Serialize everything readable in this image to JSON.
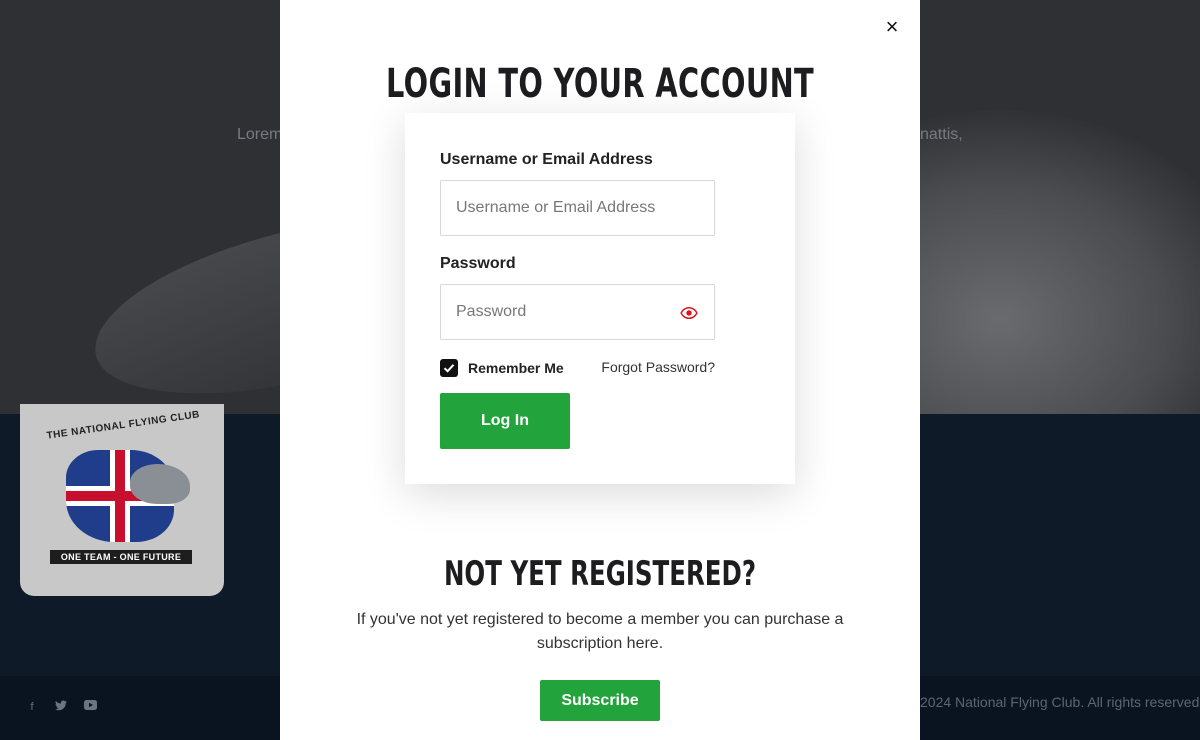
{
  "background": {
    "hero_text_left": "Lorem",
    "hero_text_right": "nattis,",
    "logo": {
      "arc_text": "THE NATIONAL FLYING CLUB",
      "banner_text": "ONE TEAM - ONE FUTURE"
    },
    "footer": {
      "social_icons": [
        "facebook-icon",
        "twitter-icon",
        "youtube-icon"
      ],
      "copyright": "2024 National Flying Club. All rights reserved."
    }
  },
  "modal": {
    "close_symbol": "×",
    "title": "LOGIN TO YOUR ACCOUNT",
    "login": {
      "username_label": "Username or Email Address",
      "username_placeholder": "Username or Email Address",
      "username_value": "",
      "password_label": "Password",
      "password_placeholder": "Password",
      "password_value": "",
      "remember_label": "Remember Me",
      "remember_checked": true,
      "forgot_label": "Forgot Password?",
      "login_button": "Log In"
    },
    "register": {
      "title": "NOT YET REGISTERED?",
      "text": "If you've not yet registered to become a member you can purchase a subscription here.",
      "subscribe_button": "Subscribe"
    }
  },
  "colors": {
    "accent_green": "#22a33c",
    "eye_icon_red": "#e0141e",
    "modal_bg": "#ffffff",
    "page_dark": "#0e1a28"
  }
}
